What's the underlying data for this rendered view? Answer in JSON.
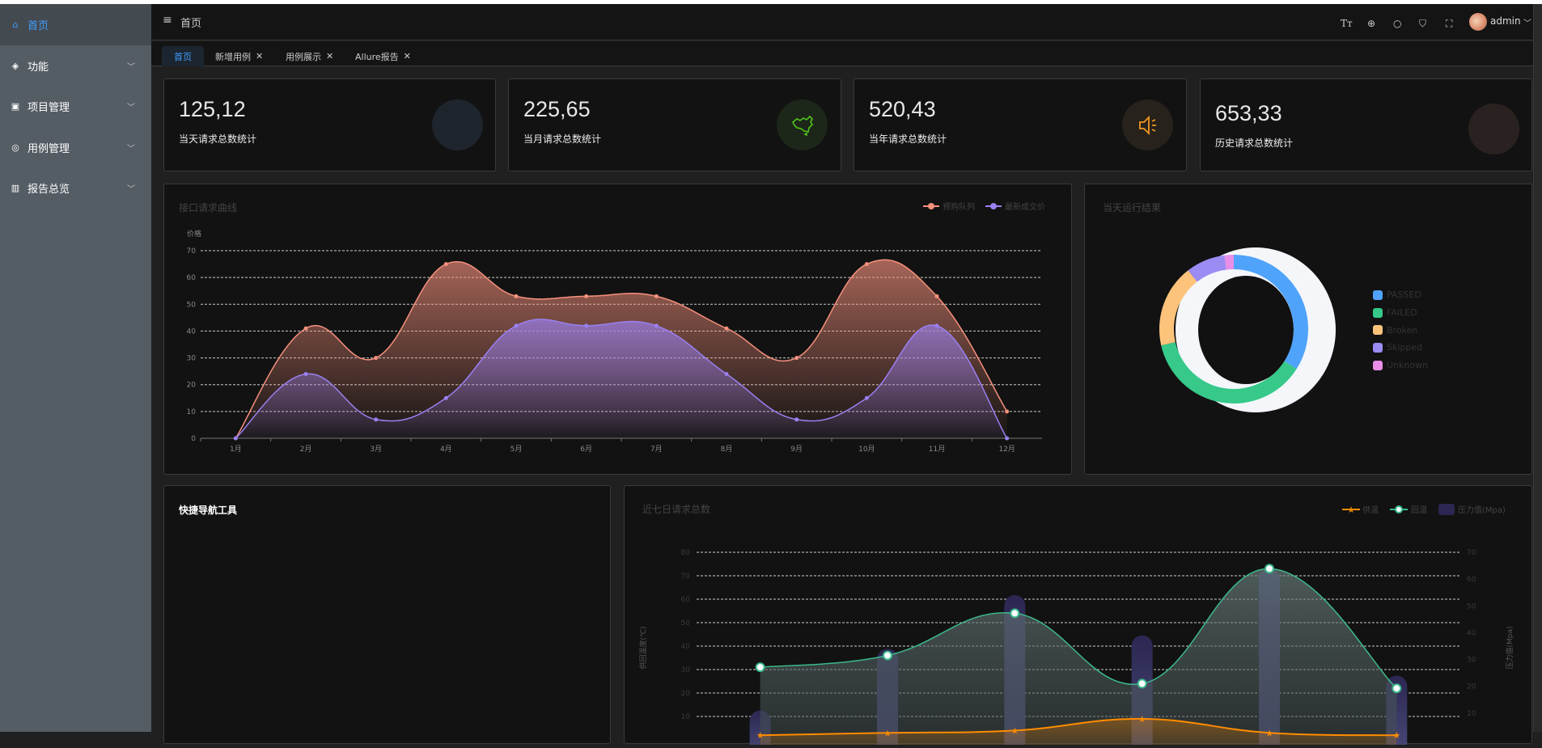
{
  "sidebar": {
    "items": [
      {
        "label": "首页",
        "icon": "home-icon",
        "active": true
      },
      {
        "label": "功能",
        "icon": "box-icon"
      },
      {
        "label": "项目管理",
        "icon": "code-icon"
      },
      {
        "label": "用例管理",
        "icon": "chat-icon"
      },
      {
        "label": "报告总览",
        "icon": "bar-chart-icon"
      }
    ]
  },
  "header": {
    "title": "首页",
    "user": "admin",
    "icons": [
      "font-size-icon",
      "language-icon",
      "search-icon",
      "theme-icon",
      "fullscreen-icon"
    ]
  },
  "tabs": [
    {
      "label": "首页",
      "active": true
    },
    {
      "label": "新增用例"
    },
    {
      "label": "用例展示"
    },
    {
      "label": "Allure报告"
    }
  ],
  "stats": [
    {
      "value": "125,12",
      "label": "当天请求总数统计",
      "icon": "none",
      "circle": "#1e252d"
    },
    {
      "value": "225,65",
      "label": "当月请求总数统计",
      "icon": "china-map-icon",
      "circle": "#1c2619",
      "color": "#52c41a"
    },
    {
      "value": "520,43",
      "label": "当年请求总数统计",
      "icon": "speaker-icon",
      "circle": "#27221b",
      "color": "#f0961e"
    },
    {
      "value": "653,33",
      "label": "历史请求总数统计",
      "icon": "none",
      "circle": "#2a2220"
    }
  ],
  "quick_nav": {
    "title": "快捷导航工具"
  },
  "chart_data": [
    {
      "type": "area",
      "title": "接口请求曲线",
      "ylabel": "价格",
      "ylim": [
        0,
        70
      ],
      "yticks": [
        0,
        10,
        20,
        30,
        40,
        50,
        60,
        70
      ],
      "grid": true,
      "legend": "top-right",
      "categories": [
        "1月",
        "2月",
        "3月",
        "4月",
        "5月",
        "6月",
        "7月",
        "8月",
        "9月",
        "10月",
        "11月",
        "12月"
      ],
      "series": [
        {
          "name": "预购队列",
          "color": "#f6917d",
          "values": [
            0,
            41,
            30,
            65,
            53,
            53,
            53,
            41,
            30,
            65,
            53,
            10
          ]
        },
        {
          "name": "最新成交价",
          "color": "#9a80f0",
          "values": [
            0,
            24,
            7,
            15,
            42,
            42,
            42,
            24,
            7,
            15,
            42,
            0
          ]
        }
      ]
    },
    {
      "type": "pie",
      "title": "当天运行结果",
      "legend": "right",
      "slices": [
        {
          "name": "PASSED",
          "value": 34,
          "color": "#4fa3fb"
        },
        {
          "name": "FAILED",
          "value": 37.5,
          "color": "#36c98a"
        },
        {
          "name": "Broken",
          "value": 18,
          "color": "#fec37a"
        },
        {
          "name": "Skipped",
          "value": 8.5,
          "color": "#9a8cf2"
        },
        {
          "name": "Unknown",
          "value": 2,
          "color": "#e88ee6"
        }
      ]
    },
    {
      "type": "bar+line",
      "title": "近七日请求总数",
      "legend": "top-right",
      "grid": true,
      "ylabel": "供回温度(℃)",
      "ylim": [
        0,
        80
      ],
      "yticks": [
        10,
        20,
        30,
        40,
        50,
        60,
        70,
        80
      ],
      "y2label": "压力值(Mpa)",
      "y2lim": [
        0,
        70
      ],
      "y2ticks": [
        10,
        20,
        30,
        40,
        50,
        60,
        70
      ],
      "series": [
        {
          "name": "供温",
          "type": "line",
          "color": "#ff8c00",
          "values": [
            2,
            3,
            4,
            9,
            3,
            2
          ]
        },
        {
          "name": "回温",
          "type": "line",
          "color": "#3bb88a",
          "values": [
            31,
            36,
            54,
            24,
            73,
            22
          ]
        },
        {
          "name": "压力值(Mpa)",
          "type": "bar",
          "axis": "right",
          "color": "#2b2752",
          "values": [
            11,
            34,
            54,
            39,
            64,
            24
          ]
        }
      ]
    }
  ]
}
